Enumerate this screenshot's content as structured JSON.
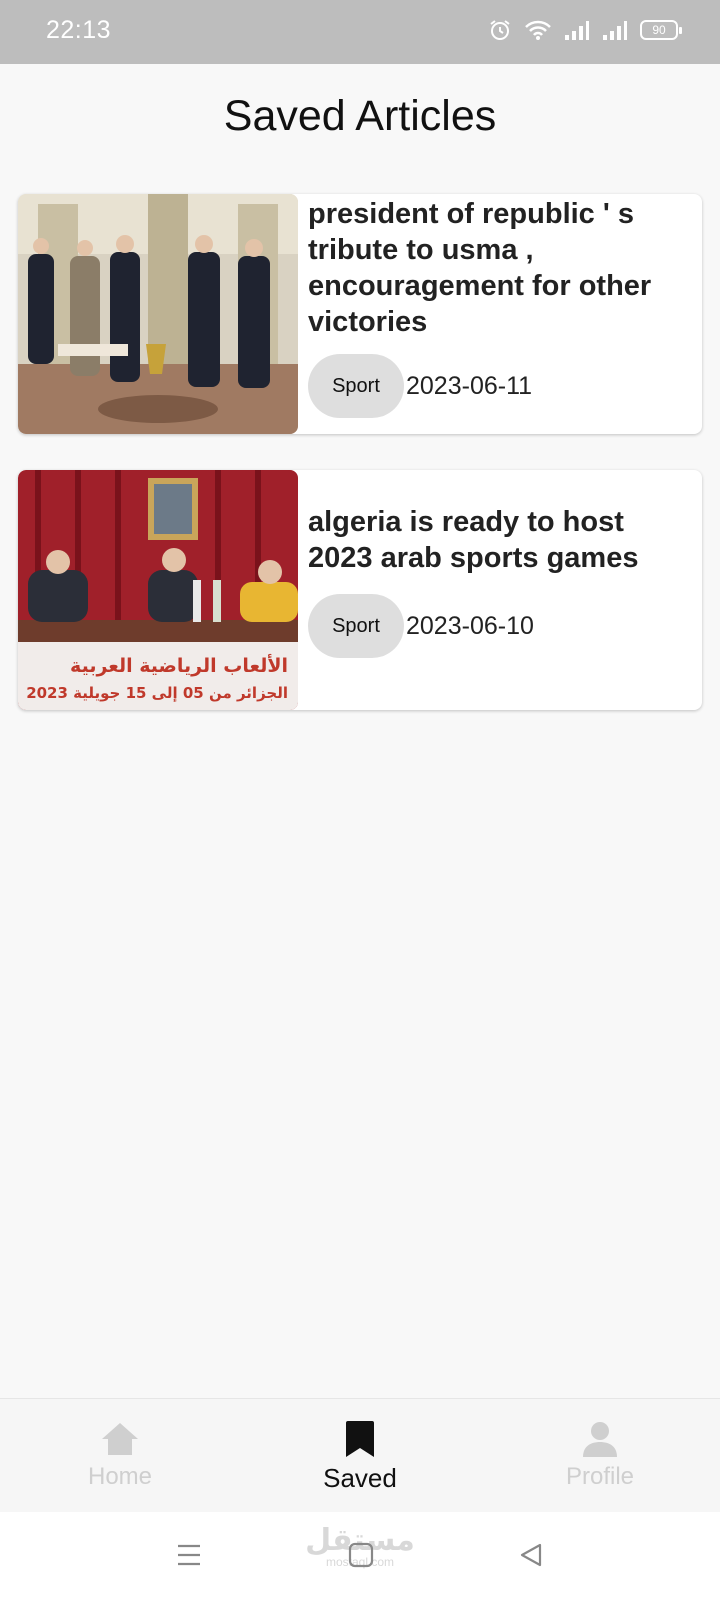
{
  "status_bar": {
    "time": "22:13",
    "battery": "90"
  },
  "page": {
    "title": "Saved Articles"
  },
  "articles": [
    {
      "title": "president of republic ' s tribute to usma , encouragement for other victories",
      "category": "Sport",
      "date": "2023-06-11",
      "image": "officials-applauding-photo"
    },
    {
      "title": "algeria is ready to host 2023 arab sports games",
      "category": "Sport",
      "date": "2023-06-10",
      "image": "press-conference-photo",
      "banner_line1": "الألعاب الرياضية العربية",
      "banner_line2": "الجزائر من 05 إلى 15 جويلية 2023"
    }
  ],
  "bottom_nav": {
    "items": [
      {
        "label": "Home",
        "icon": "home-icon",
        "active": false
      },
      {
        "label": "Saved",
        "icon": "bookmark-icon",
        "active": true
      },
      {
        "label": "Profile",
        "icon": "person-icon",
        "active": false
      }
    ]
  },
  "watermark": {
    "text": "مستقل",
    "sub": "mostaql.com"
  },
  "colors": {
    "status_bar": "#bdbdbd",
    "chip": "#dedede",
    "inactive_nav": "#cfcfcf",
    "active_nav": "#111111",
    "background": "#f8f8f8"
  }
}
